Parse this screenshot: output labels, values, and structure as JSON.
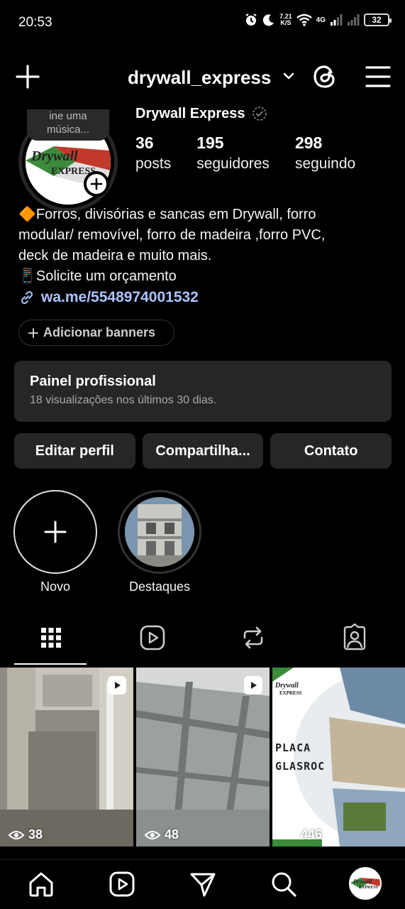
{
  "status_bar": {
    "time": "20:53",
    "net_speed_value": "7.21",
    "net_speed_unit": "K/S",
    "network_type": "4G",
    "battery": "32"
  },
  "header": {
    "username": "drywall_express"
  },
  "profile": {
    "note_line1": "ine uma",
    "note_line2": "música...",
    "avatar_logo_line1": "Drywall",
    "avatar_logo_line2": "EXPRESS",
    "name": "Drywall Express",
    "stats": [
      {
        "value": "36",
        "label": "posts"
      },
      {
        "value": "195",
        "label": "seguidores"
      },
      {
        "value": "298",
        "label": "seguindo"
      }
    ],
    "bio_line1": "🔶Forros, divisórias e sancas em Drywall, forro",
    "bio_line2": "modular/ removível, forro de madeira ,forro PVC,",
    "bio_line3": "deck de madeira e muito mais.",
    "bio_line4": "📱Solicite um orçamento",
    "link": "wa.me/5548974001532",
    "add_banners": "Adicionar banners"
  },
  "professional_panel": {
    "title": "Painel profissional",
    "subtitle": "18 visualizações nos últimos 30 dias."
  },
  "buttons": {
    "edit": "Editar perfil",
    "share": "Compartilha...",
    "contact": "Contato"
  },
  "highlights": [
    {
      "label": "Novo"
    },
    {
      "label": "Destaques"
    }
  ],
  "posts": [
    {
      "views": "38",
      "type": "reel"
    },
    {
      "views": "48",
      "type": "reel"
    },
    {
      "views": "446",
      "type": "carousel",
      "text_line1": "PLACA",
      "text_line2": "GLASROC",
      "logo_line1": "Drywall",
      "logo_line2": "EXPRESS"
    }
  ],
  "bottom_nav": {
    "avatar_logo_line1": "Drywall",
    "avatar_logo_line2": "EXPRESS"
  },
  "colors": {
    "background": "#000000",
    "surface": "#262626",
    "link": "#aac4ff",
    "muted_text": "#a8a8a8"
  }
}
